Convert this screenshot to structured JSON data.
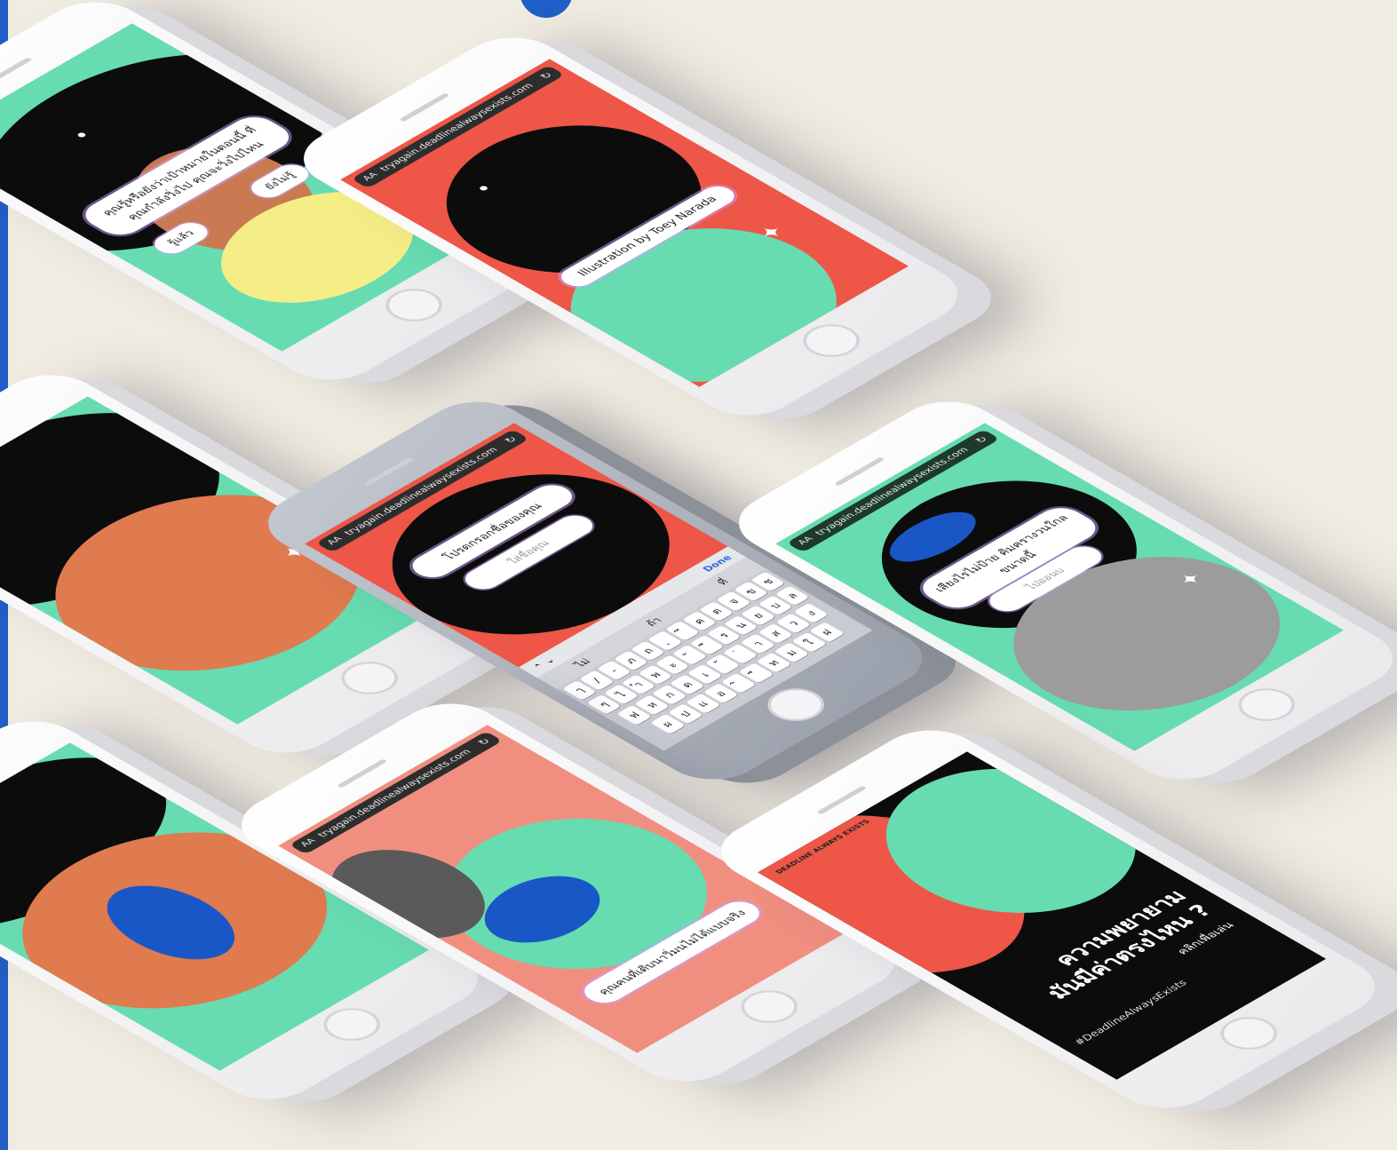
{
  "frame": {
    "accent": "#1f5fc7",
    "background": "#f1ece2"
  },
  "browser": {
    "aa_label": "AA",
    "url": "tryagain.deadlinealwaysexists.com",
    "reload_icon": "reload-icon"
  },
  "phones": {
    "question": {
      "prompt": "คุณรู้หรือยังว่าเป้าหมายในตอนนี้ ที่คุณกำลังวิ่งไป คุณจะวิ่งไปไหน",
      "option_yes": "รู้แล้ว",
      "option_no": "ยังไม่รู้"
    },
    "credit": {
      "caption": "Illustration by Toey Narada"
    },
    "name_entry": {
      "prompt": "โปรดกรอกชื่อของคุณ",
      "placeholder": "ใส่ชื่อคุณ",
      "done_label": "Done",
      "suggestion_1": "ไม่",
      "suggestion_2": "ถ้า",
      "suggestion_3": "ที่",
      "row1": [
        "ๅ",
        "/",
        "-",
        "ภ",
        "ถ",
        "ุ",
        "ึ",
        "ค",
        "ต",
        "จ",
        "ข",
        "ช"
      ],
      "row2": [
        "ๆ",
        "ไ",
        "ำ",
        "พ",
        "ะ",
        "ั",
        "ี",
        "ร",
        "น",
        "ย",
        "บ",
        "ล"
      ],
      "row3": [
        "ฟ",
        "ห",
        "ก",
        "ด",
        "เ",
        "้",
        "่",
        "า",
        "ส",
        "ว",
        "ง"
      ],
      "row4": [
        "ผ",
        "ป",
        "แ",
        "อ",
        "ิ",
        "ื",
        "ท",
        "ม",
        "ใ",
        "ฝ"
      ]
    },
    "sound": {
      "prompt": "เสียงไรไม่ป้าย คิมครางวนใกลขนาดนี้",
      "button": "ไปออนบ"
    },
    "globe": {
      "caption": "คุณคนที่เติบนาวิ่มนไม่ได้แบบจริง"
    },
    "poster": {
      "logo": "DEADLINE ALWAYS EXISTS",
      "title_line1": "ความพยายาม",
      "title_line2": "มันมีค่าตรงไหน ?",
      "subtitle": "คลิกเพื่อเล่น",
      "hashtag": "#DeadlineAlwaysExists"
    }
  },
  "colors": {
    "mint": "#67dcb0",
    "red": "#ee5648",
    "black": "#0c0c0c",
    "orange": "#e07a4f",
    "yellow": "#f5ee87",
    "blue": "#1957c7",
    "salmon": "#f08f80",
    "grey": "#9c9c9c"
  }
}
